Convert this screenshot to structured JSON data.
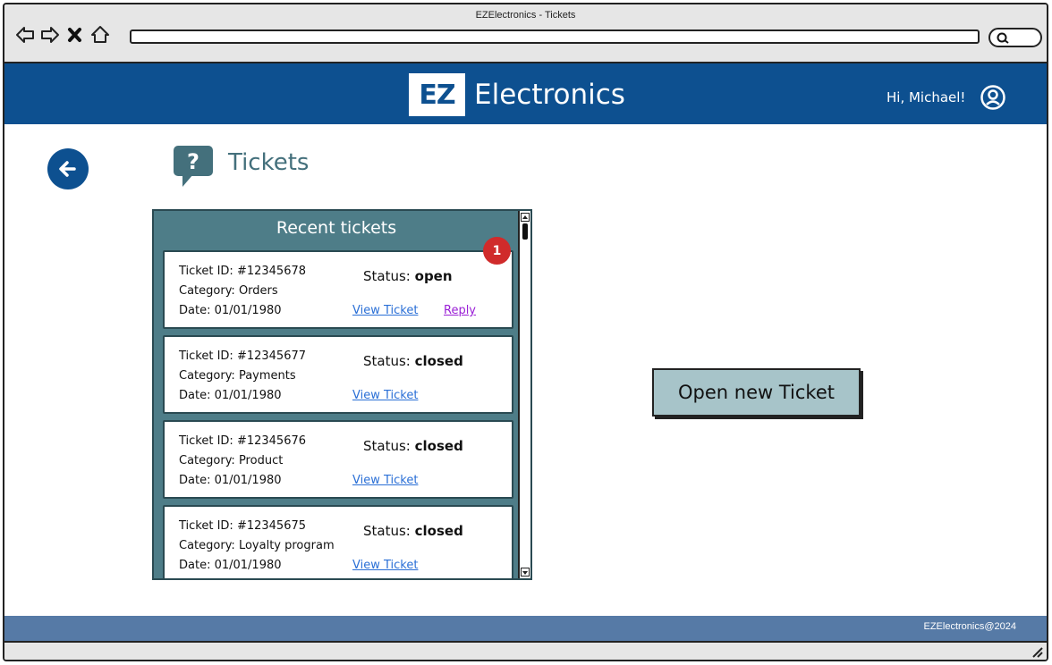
{
  "browser": {
    "window_title": "EZElectronics - Tickets",
    "url": ""
  },
  "header": {
    "logo_mark": "EZ",
    "logo_text": "Electronics",
    "greeting": "Hi, Michael!",
    "brand_color": "#0d5090"
  },
  "page": {
    "title": "Tickets",
    "title_icon": "question-speech-icon",
    "back_icon": "arrow-left-icon"
  },
  "panel": {
    "title": "Recent tickets",
    "badge_count": "1",
    "tickets": [
      {
        "id": "Ticket ID: #12345678",
        "category": "Category:  Orders",
        "date": "Date:  01/01/1980",
        "status_label": "Status:",
        "status_value": "open",
        "view_label": "View Ticket",
        "reply_label": "Reply"
      },
      {
        "id": "Ticket ID: #12345677",
        "category": "Category:  Payments",
        "date": "Date:  01/01/1980",
        "status_label": "Status:",
        "status_value": "closed",
        "view_label": "View Ticket"
      },
      {
        "id": "Ticket ID: #12345676",
        "category": "Category:  Product",
        "date": "Date:  01/01/1980",
        "status_label": "Status:",
        "status_value": "closed",
        "view_label": "View Ticket"
      },
      {
        "id": "Ticket ID: #12345675",
        "category": "Category:  Loyalty program",
        "date": "Date:  01/01/1980",
        "status_label": "Status:",
        "status_value": "closed",
        "view_label": "View Ticket"
      }
    ]
  },
  "actions": {
    "open_new_ticket_label": "Open new Ticket"
  },
  "footer": {
    "copyright": "EZElectronics@2024",
    "color": "#567aa6"
  }
}
